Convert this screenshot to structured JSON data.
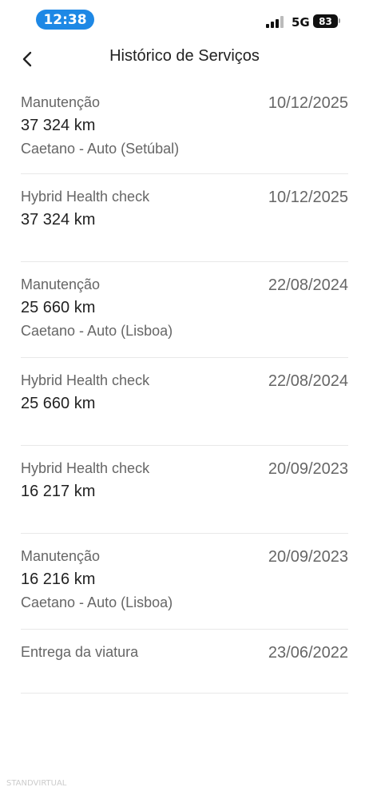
{
  "status": {
    "time": "12:38",
    "network": "5G",
    "battery": "83",
    "colors": {
      "time_pill": "#1e88e5"
    }
  },
  "header": {
    "back_icon": "chevron-left-icon",
    "title": "Histórico de Serviços"
  },
  "services": [
    {
      "type": "Manutenção",
      "km": "37 324 km",
      "dealer": "Caetano - Auto (Setúbal)",
      "date": "10/12/2025"
    },
    {
      "type": "Hybrid Health check",
      "km": "37 324 km",
      "dealer": "",
      "date": "10/12/2025"
    },
    {
      "type": "Manutenção",
      "km": "25 660 km",
      "dealer": "Caetano - Auto (Lisboa)",
      "date": "22/08/2024"
    },
    {
      "type": "Hybrid Health check",
      "km": "25 660 km",
      "dealer": "",
      "date": "22/08/2024"
    },
    {
      "type": "Hybrid Health check",
      "km": "16 217 km",
      "dealer": "",
      "date": "20/09/2023"
    },
    {
      "type": "Manutenção",
      "km": "16 216 km",
      "dealer": "Caetano - Auto (Lisboa)",
      "date": "20/09/2023"
    },
    {
      "type": "Entrega da viatura",
      "km": "",
      "dealer": "",
      "date": "23/06/2022"
    }
  ],
  "watermark": "STANDVIRTUAL"
}
